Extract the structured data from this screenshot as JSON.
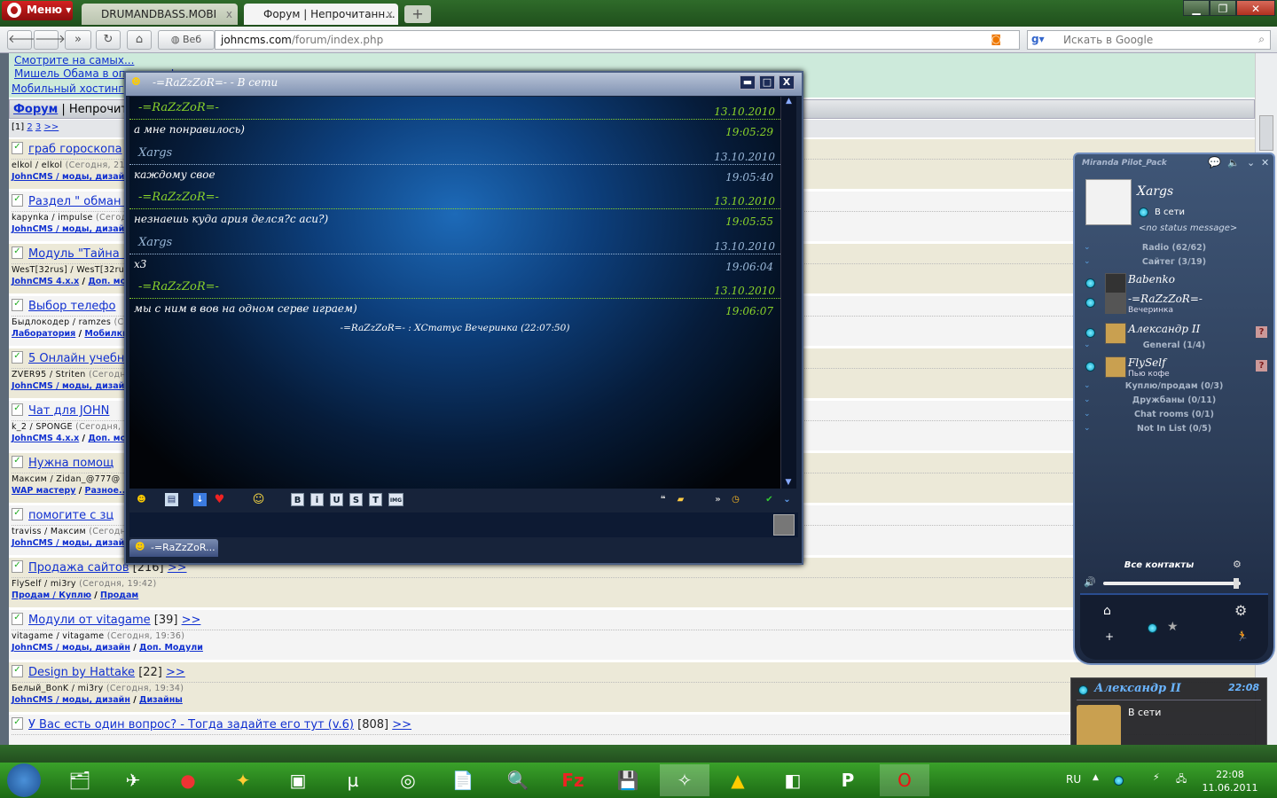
{
  "browser": {
    "menu_label": "Меню",
    "tabs": [
      {
        "label": "DRUMANDBASS.MOBI"
      },
      {
        "label": "Форум | Непрочитанн..."
      }
    ],
    "new_tab": "+",
    "web_label": "Веб",
    "url_host": "johncms.com",
    "url_path": "/forum/index.php",
    "search_placeholder": "Искать в Google"
  },
  "forum": {
    "top_links": [
      "Смотрите на самых...",
      "Мишель Обама в опасности!",
      "Мобильный хостинг"
    ],
    "breadcrumb_link": "Форум",
    "breadcrumb_rest": " | Непрочитан",
    "pagination": {
      "current": "[1]",
      "pages": [
        "2",
        "3",
        ">>"
      ]
    },
    "topics": [
      {
        "title": "граб гороскопа",
        "extra": " [6",
        "users": "elkol / elkol",
        "time": " (Сегодня, 21:5",
        "cats": [
          "JohnCMS / моды, дизайн"
        ]
      },
      {
        "title": "Раздел \" обман г",
        "extra": "",
        "users": "kapynka / impulse",
        "time": " (Сегодн",
        "cats": [
          "JohnCMS / моды, дизайн"
        ]
      },
      {
        "title": "Модуль \"Тайна и",
        "extra": "",
        "users": "WesT[32rus] / WesT[32rus]",
        "time": "",
        "cats": [
          "JohnCMS 4.x.x",
          "Доп. мод"
        ]
      },
      {
        "title": "Выбор телефо",
        "extra": "",
        "users": "Быдлокодер / ramzes",
        "time": " (Се",
        "cats": [
          "Лаборатория",
          "Мобилки"
        ]
      },
      {
        "title": "5 Онлайн учебни",
        "extra": "",
        "users": "ZVER95 / Striten",
        "time": " (Сегодня",
        "cats": [
          "JohnCMS / моды, дизайн"
        ]
      },
      {
        "title": "Чат для JOHN",
        "extra": "",
        "users": "k_2 / SPONGE",
        "time": " (Сегодня, 2",
        "cats": [
          "JohnCMS 4.x.x",
          "Доп. мод"
        ]
      },
      {
        "title": "Нужна помощ",
        "extra": "",
        "users": "Максим / Zidan_@777@",
        "time": "",
        "cats": [
          "WAP мастеру",
          "Разное..."
        ]
      },
      {
        "title": "помогите с зц",
        "extra": "",
        "users": "traviss / Максим",
        "time": " (Сегодня,",
        "cats": [
          "JohnCMS / моды, дизайн"
        ]
      },
      {
        "title": "Продажа сайтов",
        "extra": " [216] ",
        "more": ">>",
        "users": "FlySelf / mi3ry",
        "time": " (Сегодня, 19:42)",
        "cats": [
          "Продам / Куплю",
          "Продам"
        ]
      },
      {
        "title": "Модули от vitagame",
        "extra": " [39] ",
        "more": ">>",
        "users": "vitagame / vitagame",
        "time": " (Сегодня, 19:36)",
        "cats": [
          "JohnCMS / моды, дизайн",
          "Доп. Модули"
        ]
      },
      {
        "title": "Design by Hattake",
        "extra": " [22] ",
        "more": ">>",
        "users": "Белый_BonK / mi3ry",
        "time": " (Сегодня, 19:34)",
        "cats": [
          "JohnCMS / моды, дизайн",
          "Дизайны"
        ]
      },
      {
        "title": "У Вас есть один вопрос? - Тогда задайте его тут (v.6)",
        "extra": " [808] ",
        "more": ">>",
        "users": "",
        "time": "",
        "cats": []
      }
    ]
  },
  "chat": {
    "title": "-=RaZzZoR=- - В сети",
    "messages": [
      {
        "nick": "-=RaZzZoR=-",
        "date": "13.10.2010",
        "text": "а мне понравилось)",
        "time": "19:05:29",
        "mine": false
      },
      {
        "nick": "Xargs",
        "date": "13.10.2010",
        "text": "каждому свое",
        "time": "19:05:40",
        "mine": true
      },
      {
        "nick": "-=RaZzZoR=-",
        "date": "13.10.2010",
        "text": "незнаешь куда ария делся?с аси?)",
        "time": "19:05:55",
        "mine": false
      },
      {
        "nick": "Xargs",
        "date": "13.10.2010",
        "text": "х3",
        "time": "19:06:04",
        "mine": true
      },
      {
        "nick": "-=RaZzZoR=-",
        "date": "13.10.2010",
        "text": "мы с ним в вов на одном серве играем)",
        "time": "19:06:07",
        "mine": false
      }
    ],
    "status_line": "-=RaZzZoR=- : ХСтатус Вечеринка (22:07:50)",
    "tab_label": "-=RaZzZoR...",
    "format_buttons": [
      "B",
      "i",
      "U",
      "S",
      "T",
      "IMG"
    ]
  },
  "miranda": {
    "title": "Miranda Pilot_Pack",
    "user": "Xargs",
    "status": "В сети",
    "status_msg": "<no status message>",
    "list": [
      {
        "type": "group",
        "label": "Radio  (62/62)"
      },
      {
        "type": "group",
        "label": "Сайтег  (3/19)"
      },
      {
        "type": "contact",
        "name": "Babenko",
        "sub": ""
      },
      {
        "type": "contact",
        "name": "-=RaZzZoR=-",
        "sub": "Вечеринка"
      },
      {
        "type": "contact",
        "name": "Александр II",
        "sub": ""
      },
      {
        "type": "group",
        "label": "General  (1/4)"
      },
      {
        "type": "contact",
        "name": "FlySelf",
        "sub": "Пью кофе"
      },
      {
        "type": "group",
        "label": "Куплю/продам  (0/3)"
      },
      {
        "type": "group",
        "label": "Дружбаны  (0/11)"
      },
      {
        "type": "group",
        "label": "Chat rooms  (0/1)"
      },
      {
        "type": "group",
        "label": "Not In List  (0/5)"
      }
    ],
    "all_contacts": "Все контакты",
    "volume": 0.98
  },
  "popup": {
    "name": "Александр II",
    "time": "22:08",
    "status": "В сети"
  },
  "taskbar": {
    "lang": "RU",
    "time": "22:08",
    "date": "11.06.2011"
  }
}
